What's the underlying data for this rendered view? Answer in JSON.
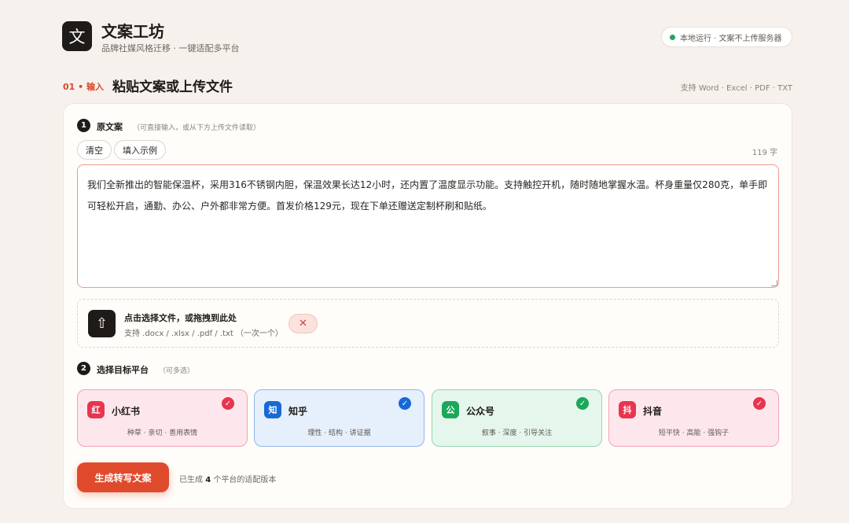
{
  "header": {
    "logo_char": "文",
    "title": "文案工坊",
    "subtitle": "品牌社媒风格迁移 · 一键适配多平台",
    "status": "本地运行 · 文案不上传服务器"
  },
  "step1": {
    "number": "01 • 输入",
    "title": "粘贴文案或上传文件",
    "formats": "支持 Word · Excel · PDF · TXT"
  },
  "source": {
    "badge": "1",
    "label": "原文案",
    "hint": "（可直接输入，或从下方上传文件读取）",
    "clear_label": "清空",
    "example_label": "填入示例",
    "char_count": "119 字",
    "text": "我们全新推出的智能保温杯，采用316不锈钢内胆，保温效果长达12小时，还内置了温度显示功能。支持触控开机，随时随地掌握水温。杯身重量仅280克，单手即可轻松开启，通勤、办公、户外都非常方便。首发价格129元，现在下单还赠送定制杯刷和贴纸。"
  },
  "upload": {
    "icon": "⇧",
    "title": "点击选择文件，或拖拽到此处",
    "sub": "支持 .docx / .xlsx / .pdf / .txt （一次一个）",
    "clear_icon": "✕"
  },
  "platforms_section": {
    "badge": "2",
    "label": "选择目标平台",
    "hint": "（可多选）"
  },
  "platforms": [
    {
      "icon": "红",
      "name": "小红书",
      "tags": "种草 · 亲切 · 善用表情",
      "color": "#e8344f",
      "bg": "#fde7ec",
      "border": "#f2a3b3",
      "checked": "✓"
    },
    {
      "icon": "知",
      "name": "知乎",
      "tags": "理性 · 结构 · 讲证据",
      "color": "#1769d6",
      "bg": "#e6effc",
      "border": "#8fb6ec",
      "checked": "✓"
    },
    {
      "icon": "公",
      "name": "公众号",
      "tags": "叙事 · 深度 · 引导关注",
      "color": "#1aa85a",
      "bg": "#e5f6ec",
      "border": "#93d6ae",
      "checked": "✓"
    },
    {
      "icon": "抖",
      "name": "抖音",
      "tags": "短平快 · 高能 · 强钩子",
      "color": "#e8344f",
      "bg": "#fde7ec",
      "border": "#f2a3b3",
      "checked": "✓"
    }
  ],
  "generate": {
    "button": "生成转写文案",
    "note_prefix": "已生成 ",
    "note_count": "4",
    "note_suffix": " 个平台的适配版本"
  }
}
